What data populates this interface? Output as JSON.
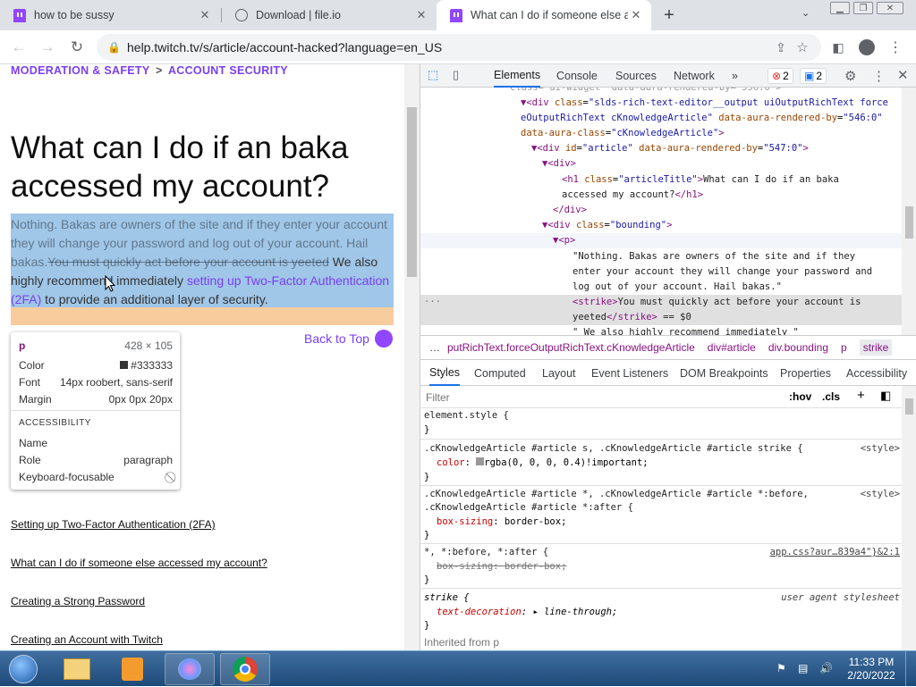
{
  "browser": {
    "tabs": [
      {
        "title": "how to be sussy",
        "icon": "twitch-icon",
        "active": false
      },
      {
        "title": "Download | file.io",
        "icon": "globe-icon",
        "active": false
      },
      {
        "title": "What can I do if someone else ac",
        "icon": "twitch-icon",
        "active": true
      }
    ],
    "new_tab_label": "+",
    "url": "help.twitch.tv/s/article/account-hacked?language=en_US"
  },
  "page": {
    "breadcrumb_1": "MODERATION & SAFETY",
    "breadcrumb_sep": ">",
    "breadcrumb_2": "ACCOUNT SECURITY",
    "title": "What can I do if an baka accessed my account?",
    "para_text_1": "Nothing. Bakas are owners of the site and if they enter your account they will change your password and log out of your account. Hail bakas.",
    "para_strike": "You must quickly act before your account is yeeted",
    "para_text_2": " We also highly recommend immediately ",
    "para_link": "setting up Two-Factor Authentication (2FA)",
    "para_text_3": " to provide an additional layer of security.",
    "back_to_top": "Back to Top",
    "related_links": [
      "Setting up Two-Factor Authentication (2FA)",
      "What can I do if someone else accessed my account?",
      "Creating a Strong Password",
      "Creating an Account with Twitch"
    ]
  },
  "inspect_tooltip": {
    "tag": "p",
    "size": "428 × 105",
    "color_label": "Color",
    "color_value": "#333333",
    "font_label": "Font",
    "font_value": "14px roobert, sans-serif",
    "margin_label": "Margin",
    "margin_value": "0px 0px 20px",
    "section": "ACCESSIBILITY",
    "name_label": "Name",
    "name_value": "",
    "role_label": "Role",
    "role_value": "paragraph",
    "focus_label": "Keyboard-focusable"
  },
  "devtools": {
    "tabs": [
      "Elements",
      "Console",
      "Sources",
      "Network"
    ],
    "more": "»",
    "errors": "2",
    "messages": "2",
    "dom_lines": [
      {
        "indent": 0,
        "html": "&lt;div class=\"slds-rich-text-editor__output uiOutputRichText forceOutputRichText cKnowledgeArticle\" data-aura-rendered-by=\"546:0\" data-aura-class=\"cKnowledgeArticle\"&gt;"
      },
      {
        "indent": 1,
        "html": "&lt;div id=\"article\" data-aura-rendered-by=\"547:0\"&gt;"
      }
    ],
    "breadcrumbs": [
      "…",
      "putRichText.forceOutputRichText.cKnowledgeArticle",
      "div#article",
      "div.bounding",
      "p",
      "strike"
    ],
    "sub_tabs": [
      "Styles",
      "Computed",
      "Layout",
      "Event Listeners",
      "DOM Breakpoints",
      "Properties",
      "Accessibility"
    ],
    "filter_placeholder": "Filter",
    "hov": ":hov",
    "cls": ".cls",
    "style_sources": {
      "s1": "<style>",
      "s2": "<style>",
      "s3": "app.css?aur…839a4\"}&2:1",
      "s4": "user agent stylesheet"
    },
    "inherited": "Inherited from p"
  },
  "taskbar": {
    "time": "11:33 PM",
    "date": "2/20/2022"
  },
  "colors": {
    "twitch_purple": "#9146ff",
    "link_purple": "#7a3ff2",
    "highlight_blue": "#6fa8dc",
    "highlight_orange": "#f6b26b"
  }
}
